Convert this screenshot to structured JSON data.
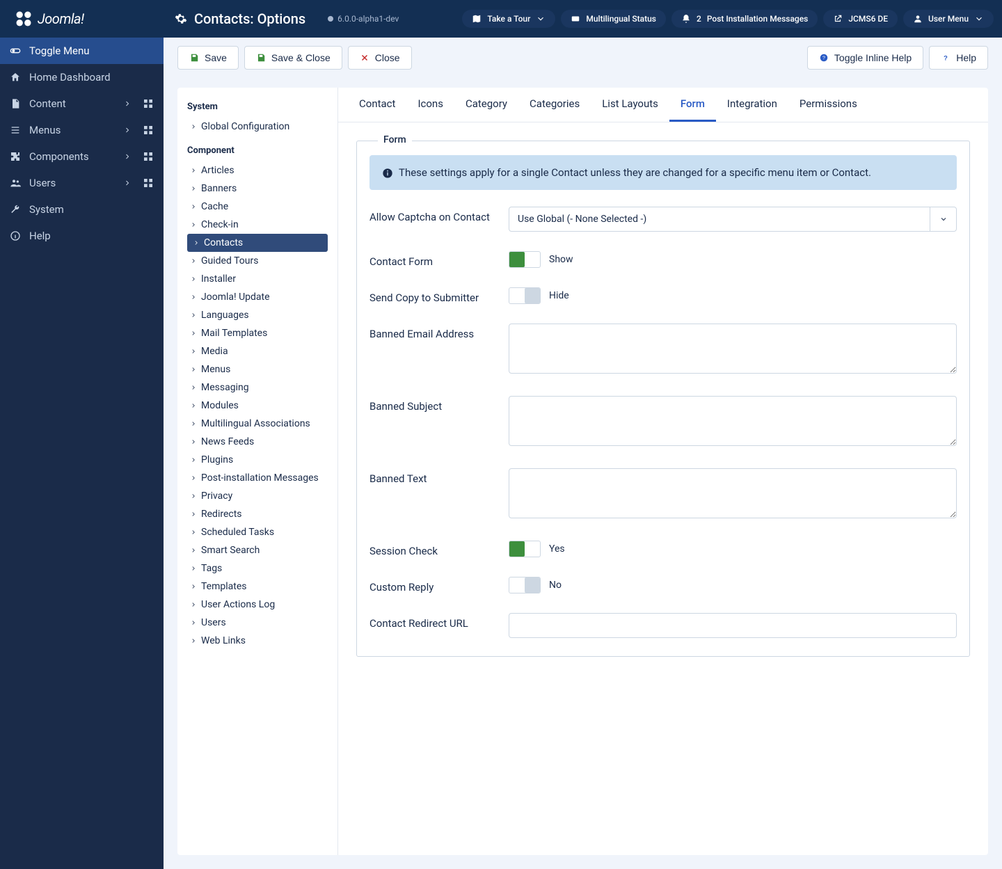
{
  "brand": "Joomla!",
  "header": {
    "title": "Contacts: Options",
    "version": "6.0.0-alpha1-dev",
    "pills": {
      "tour": "Take a Tour",
      "multilingual": "Multilingual Status",
      "post_count": "2",
      "post_label": "Post Installation Messages",
      "site": "JCMS6 DE",
      "user": "User Menu"
    }
  },
  "sidebar": {
    "toggle": "Toggle Menu",
    "home": "Home Dashboard",
    "content": "Content",
    "menus": "Menus",
    "components": "Components",
    "users": "Users",
    "system": "System",
    "help": "Help"
  },
  "toolbar": {
    "save": "Save",
    "save_close": "Save & Close",
    "close": "Close",
    "inline_help": "Toggle Inline Help",
    "help": "Help"
  },
  "side_panel": {
    "system_heading": "System",
    "global_config": "Global Configuration",
    "component_heading": "Component",
    "items": [
      "Articles",
      "Banners",
      "Cache",
      "Check-in",
      "Contacts",
      "Guided Tours",
      "Installer",
      "Joomla! Update",
      "Languages",
      "Mail Templates",
      "Media",
      "Menus",
      "Messaging",
      "Modules",
      "Multilingual Associations",
      "News Feeds",
      "Plugins",
      "Post-installation Messages",
      "Privacy",
      "Redirects",
      "Scheduled Tasks",
      "Smart Search",
      "Tags",
      "Templates",
      "User Actions Log",
      "Users",
      "Web Links"
    ]
  },
  "tabs": [
    "Contact",
    "Icons",
    "Category",
    "Categories",
    "List Layouts",
    "Form",
    "Integration",
    "Permissions"
  ],
  "form": {
    "legend": "Form",
    "info": "These settings apply for a single Contact unless they are changed for a specific menu item or Contact.",
    "captcha_label": "Allow Captcha on Contact",
    "captcha_value": "Use Global (- None Selected -)",
    "contact_form_label": "Contact Form",
    "contact_form_state": "Show",
    "send_copy_label": "Send Copy to Submitter",
    "send_copy_state": "Hide",
    "banned_email_label": "Banned Email Address",
    "banned_subject_label": "Banned Subject",
    "banned_text_label": "Banned Text",
    "session_label": "Session Check",
    "session_state": "Yes",
    "reply_label": "Custom Reply",
    "reply_state": "No",
    "redirect_label": "Contact Redirect URL"
  }
}
